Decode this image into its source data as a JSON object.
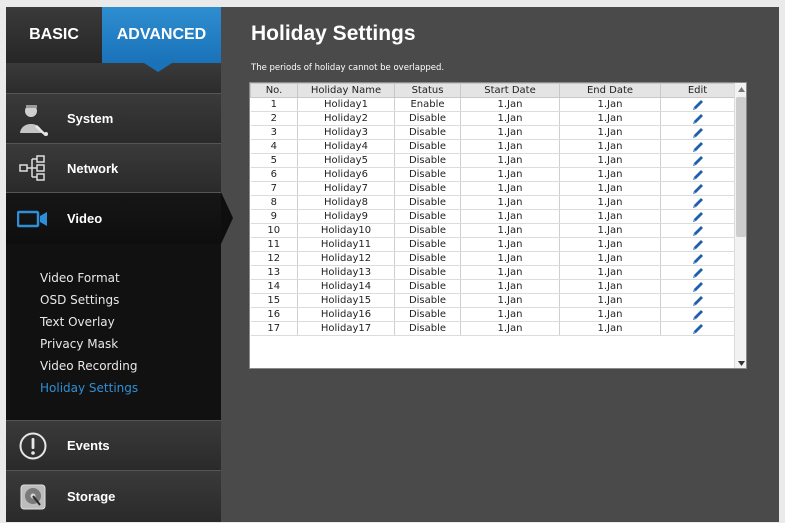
{
  "mode_tabs": {
    "basic": "BASIC",
    "advanced": "ADVANCED"
  },
  "menu": {
    "system": "System",
    "network": "Network",
    "video": "Video",
    "events": "Events",
    "storage": "Storage"
  },
  "video_submenu": [
    "Video Format",
    "OSD Settings",
    "Text Overlay",
    "Privacy Mask",
    "Video Recording",
    "Holiday Settings"
  ],
  "page": {
    "title": "Holiday Settings",
    "note": "The periods of holiday cannot be overlapped."
  },
  "table": {
    "headers": [
      "No.",
      "Holiday Name",
      "Status",
      "Start Date",
      "End Date",
      "Edit"
    ],
    "rows": [
      {
        "no": "1",
        "name": "Holiday1",
        "status": "Enable",
        "start": "1.Jan",
        "end": "1.Jan"
      },
      {
        "no": "2",
        "name": "Holiday2",
        "status": "Disable",
        "start": "1.Jan",
        "end": "1.Jan"
      },
      {
        "no": "3",
        "name": "Holiday3",
        "status": "Disable",
        "start": "1.Jan",
        "end": "1.Jan"
      },
      {
        "no": "4",
        "name": "Holiday4",
        "status": "Disable",
        "start": "1.Jan",
        "end": "1.Jan"
      },
      {
        "no": "5",
        "name": "Holiday5",
        "status": "Disable",
        "start": "1.Jan",
        "end": "1.Jan"
      },
      {
        "no": "6",
        "name": "Holiday6",
        "status": "Disable",
        "start": "1.Jan",
        "end": "1.Jan"
      },
      {
        "no": "7",
        "name": "Holiday7",
        "status": "Disable",
        "start": "1.Jan",
        "end": "1.Jan"
      },
      {
        "no": "8",
        "name": "Holiday8",
        "status": "Disable",
        "start": "1.Jan",
        "end": "1.Jan"
      },
      {
        "no": "9",
        "name": "Holiday9",
        "status": "Disable",
        "start": "1.Jan",
        "end": "1.Jan"
      },
      {
        "no": "10",
        "name": "Holiday10",
        "status": "Disable",
        "start": "1.Jan",
        "end": "1.Jan"
      },
      {
        "no": "11",
        "name": "Holiday11",
        "status": "Disable",
        "start": "1.Jan",
        "end": "1.Jan"
      },
      {
        "no": "12",
        "name": "Holiday12",
        "status": "Disable",
        "start": "1.Jan",
        "end": "1.Jan"
      },
      {
        "no": "13",
        "name": "Holiday13",
        "status": "Disable",
        "start": "1.Jan",
        "end": "1.Jan"
      },
      {
        "no": "14",
        "name": "Holiday14",
        "status": "Disable",
        "start": "1.Jan",
        "end": "1.Jan"
      },
      {
        "no": "15",
        "name": "Holiday15",
        "status": "Disable",
        "start": "1.Jan",
        "end": "1.Jan"
      },
      {
        "no": "16",
        "name": "Holiday16",
        "status": "Disable",
        "start": "1.Jan",
        "end": "1.Jan"
      },
      {
        "no": "17",
        "name": "Holiday17",
        "status": "Disable",
        "start": "1.Jan",
        "end": "1.Jan"
      }
    ]
  },
  "icons": {
    "system": "admin-user-icon",
    "network": "network-tree-icon",
    "video": "video-camera-icon",
    "events": "exclamation-circle-icon",
    "storage": "hard-drive-icon",
    "edit": "pencil-icon"
  },
  "colors": {
    "accent": "#1a72b8",
    "active_submenu": "#2f8fd6",
    "sidebar_bg": "#1a1a1a",
    "main_bg": "#4a4a4a",
    "edit_icon": "#1f5fa8"
  }
}
